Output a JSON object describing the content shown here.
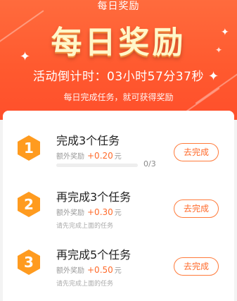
{
  "header": {
    "nav_title": "每日奖励",
    "banner_title": "每日奖励",
    "countdown": "活动倒计时：03小时57分37秒",
    "subtitle": "每日完成任务，就可获得奖励"
  },
  "colors": {
    "header_bg": "#ff5a2f",
    "accent": "#ff6a2a",
    "badge": "#ff9b1f"
  },
  "tasks": [
    {
      "number": "1",
      "title": "完成3个任务",
      "reward_label": "额外奖励",
      "reward_amount": "+0.20",
      "reward_unit": "元",
      "progress_text": "0/3",
      "progress_fraction": 0,
      "button_label": "去完成",
      "hint": ""
    },
    {
      "number": "2",
      "title": "再完成3个任务",
      "reward_label": "额外奖励",
      "reward_amount": "+0.30",
      "reward_unit": "元",
      "hint": "请先完成上面的任务",
      "button_label": "去完成"
    },
    {
      "number": "3",
      "title": "再完成5个任务",
      "reward_label": "额外奖励",
      "reward_amount": "+0.50",
      "reward_unit": "元",
      "hint": "请先完成上面的任务",
      "button_label": "去完成"
    }
  ]
}
